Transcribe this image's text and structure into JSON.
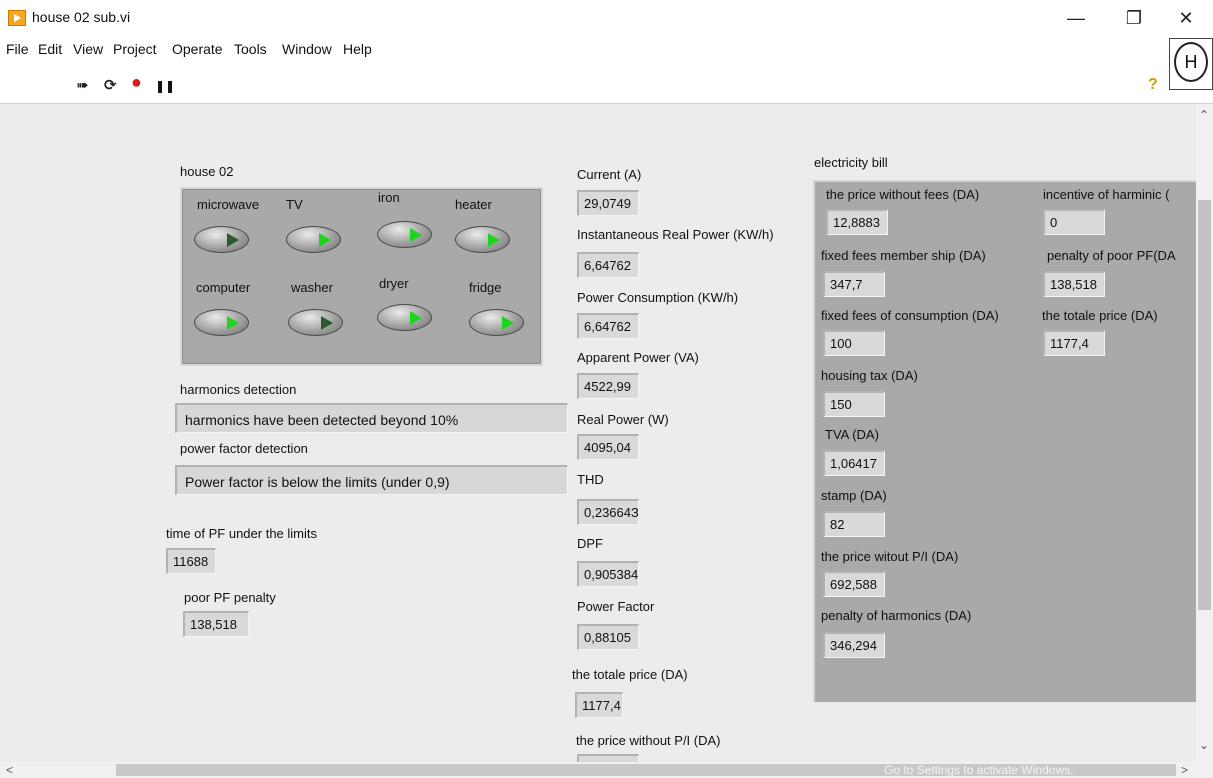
{
  "window": {
    "title": "house 02 sub.vi",
    "minimize": "—",
    "maximize": "❐",
    "close": "✕"
  },
  "menu": [
    "File",
    "Edit",
    "View",
    "Project",
    "Operate",
    "Tools",
    "Window",
    "Help"
  ],
  "toolbar": {
    "run": "➠",
    "run_continuous": "⟳",
    "abort": "●",
    "pause": "❚❚",
    "help_q": "?",
    "help_h": "H"
  },
  "house": {
    "title": "house 02",
    "appliances": [
      {
        "label": "microwave",
        "on": false
      },
      {
        "label": "TV",
        "on": true
      },
      {
        "label": "iron",
        "on": true
      },
      {
        "label": "heater",
        "on": true
      },
      {
        "label": "computer",
        "on": true
      },
      {
        "label": "washer",
        "on": false
      },
      {
        "label": "dryer",
        "on": true
      },
      {
        "label": "fridge",
        "on": true
      }
    ]
  },
  "harmonics": {
    "label": "harmonics detection",
    "value": "harmonics have been detected beyond 10%"
  },
  "pf_detection": {
    "label": "power factor detection",
    "value": "Power factor is below the limits (under 0,9)"
  },
  "pf_time": {
    "label": "time of PF under the limits",
    "value": "11688"
  },
  "pf_penalty": {
    "label": "poor PF penalty",
    "value": "138,518"
  },
  "measures": [
    {
      "label": "Current (A)",
      "value": "29,0749"
    },
    {
      "label": "Instantaneous Real Power (KW/h)",
      "value": "6,64762"
    },
    {
      "label": "Power Consumption (KW/h)",
      "value": "6,64762"
    },
    {
      "label": "Apparent Power (VA)",
      "value": "4522,99"
    },
    {
      "label": "Real Power (W)",
      "value": "4095,04"
    },
    {
      "label": "THD",
      "value": "0,23664З"
    },
    {
      "label": "DPF",
      "value": "0,905384"
    },
    {
      "label": "Power Factor",
      "value": "0,88105"
    },
    {
      "label": "the totale price (DA)",
      "value": "1177,4"
    },
    {
      "label": "the  price without P/I (DA)",
      "value": ""
    }
  ],
  "bill": {
    "title": "electricity bill",
    "left": [
      {
        "label": "the price without fees  (DA)",
        "value": "12,8883"
      },
      {
        "label": "fixed fees member ship (DA)",
        "value": "347,7"
      },
      {
        "label": "fixed fees of consumption  (DA)",
        "value": "100"
      },
      {
        "label": "housing tax (DA)",
        "value": "150"
      },
      {
        "label": "TVA (DA)",
        "value": "1,06417"
      },
      {
        "label": "stamp (DA)",
        "value": "82"
      },
      {
        "label": "the price witout P/I (DA)",
        "value": "692,588"
      },
      {
        "label": "penalty of harmonics (DA)",
        "value": "346,294"
      }
    ],
    "right": [
      {
        "label": "incentive of harminic (",
        "value": "0"
      },
      {
        "label": "penalty of poor PF(DA",
        "value": "138,518"
      },
      {
        "label": "the totale price (DA)",
        "value": "1177,4"
      }
    ]
  },
  "scroll": {
    "up": "⌃",
    "down": "⌄",
    "left": "<",
    "right": ">"
  },
  "watermark": "Go to Settings to activate Windows."
}
